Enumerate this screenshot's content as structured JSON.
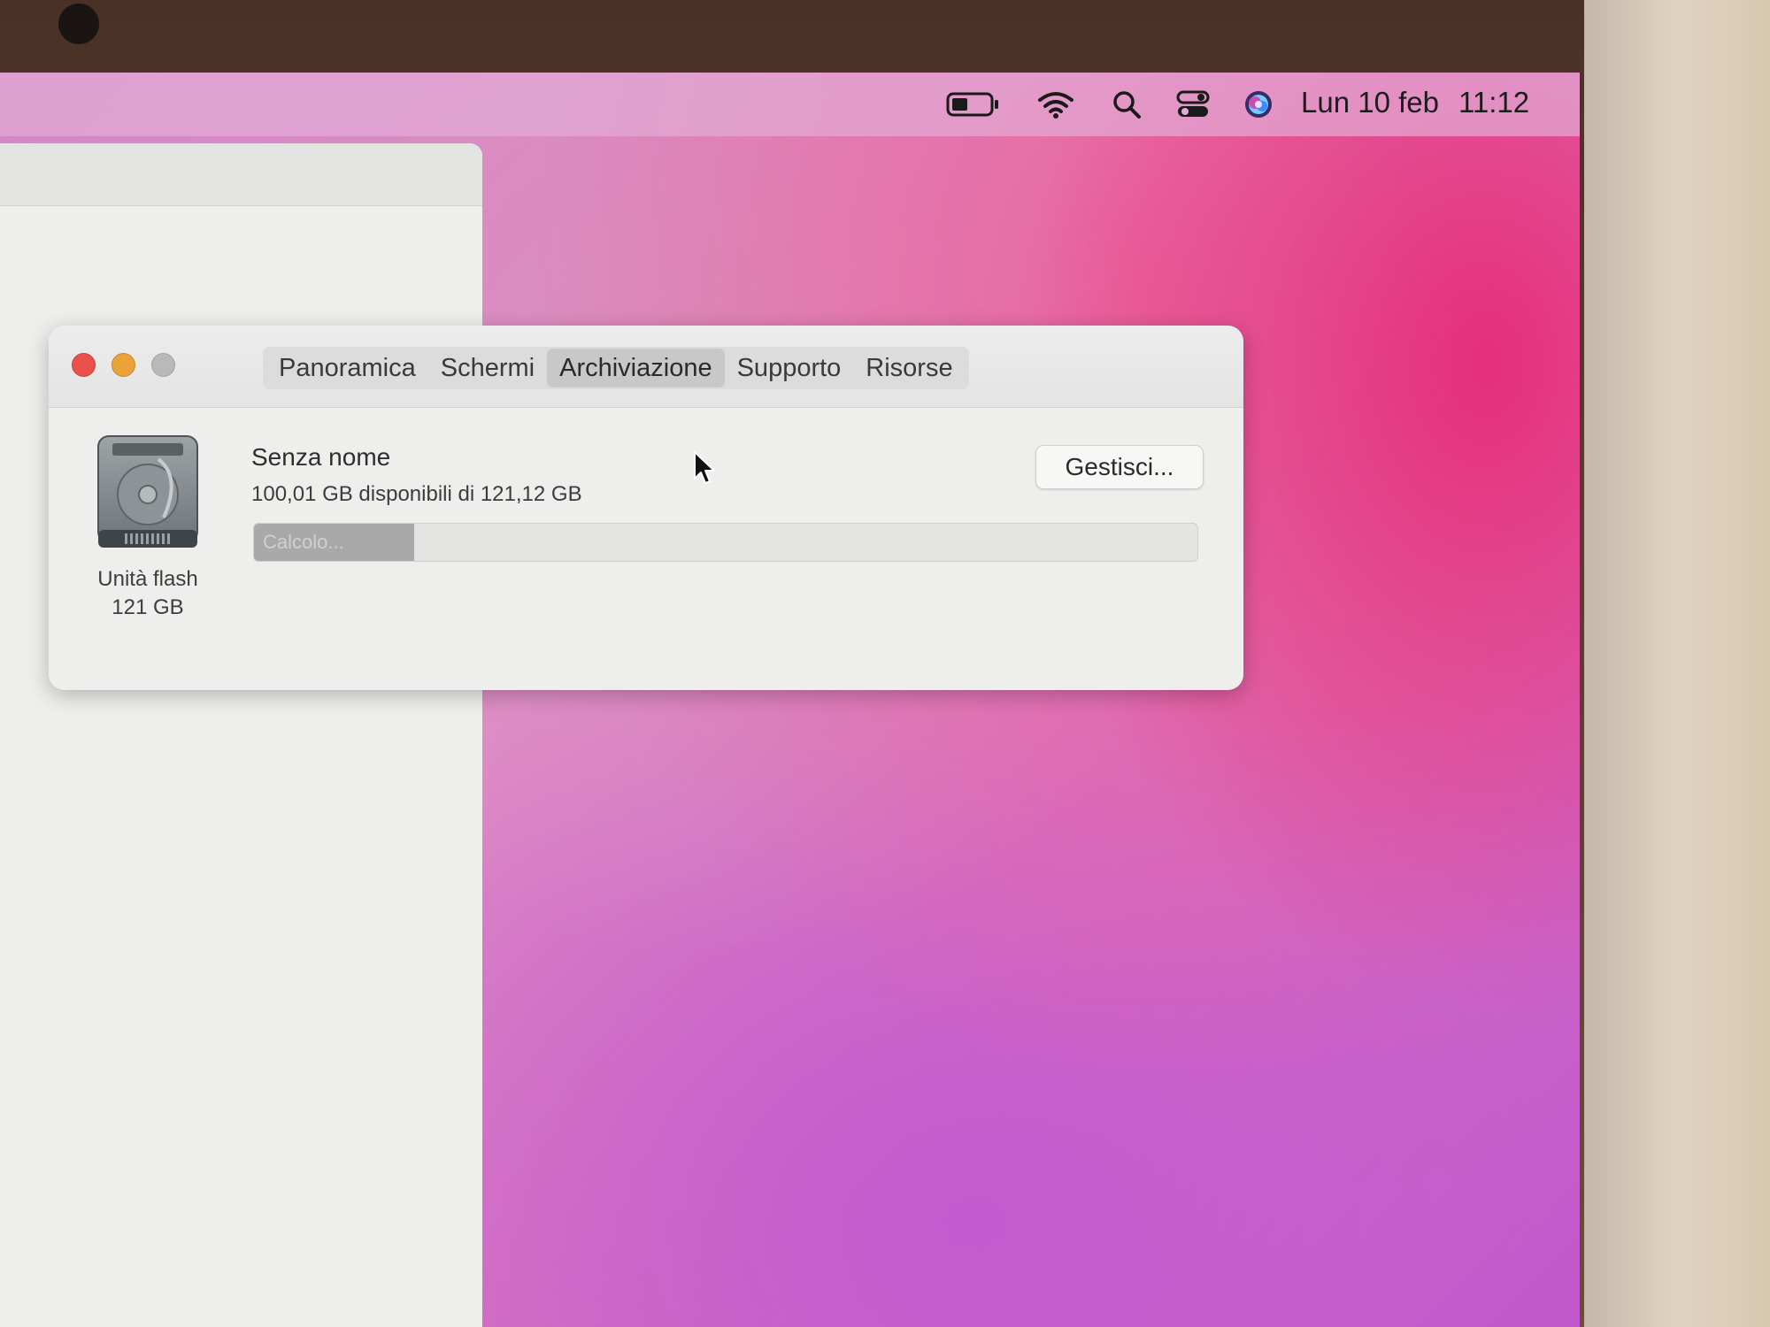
{
  "menubar": {
    "date": "Lun 10 feb",
    "time": "11:12",
    "icons": [
      "battery-icon",
      "wifi-icon",
      "spotlight-search-icon",
      "control-center-icon",
      "siri-icon"
    ]
  },
  "window": {
    "tabs": [
      {
        "label": "Panoramica",
        "active": false
      },
      {
        "label": "Schermi",
        "active": false
      },
      {
        "label": "Archiviazione",
        "active": true
      },
      {
        "label": "Supporto",
        "active": false
      },
      {
        "label": "Risorse",
        "active": false
      }
    ],
    "volume": {
      "name": "Senza nome",
      "availability": "100,01 GB disponibili di 121,12 GB",
      "status": "Calcolo...",
      "progress_fraction": 0.17,
      "device_label_line1": "Unità flash",
      "device_label_line2": "121 GB"
    },
    "manage_button": "Gestisci..."
  },
  "colors": {
    "close": "#e9524a",
    "minimize": "#e9a33a",
    "zoom_inactive": "#b9b9b9",
    "wallpaper_pink": "#e52f7a",
    "wallpaper_purple": "#c35ad0"
  }
}
